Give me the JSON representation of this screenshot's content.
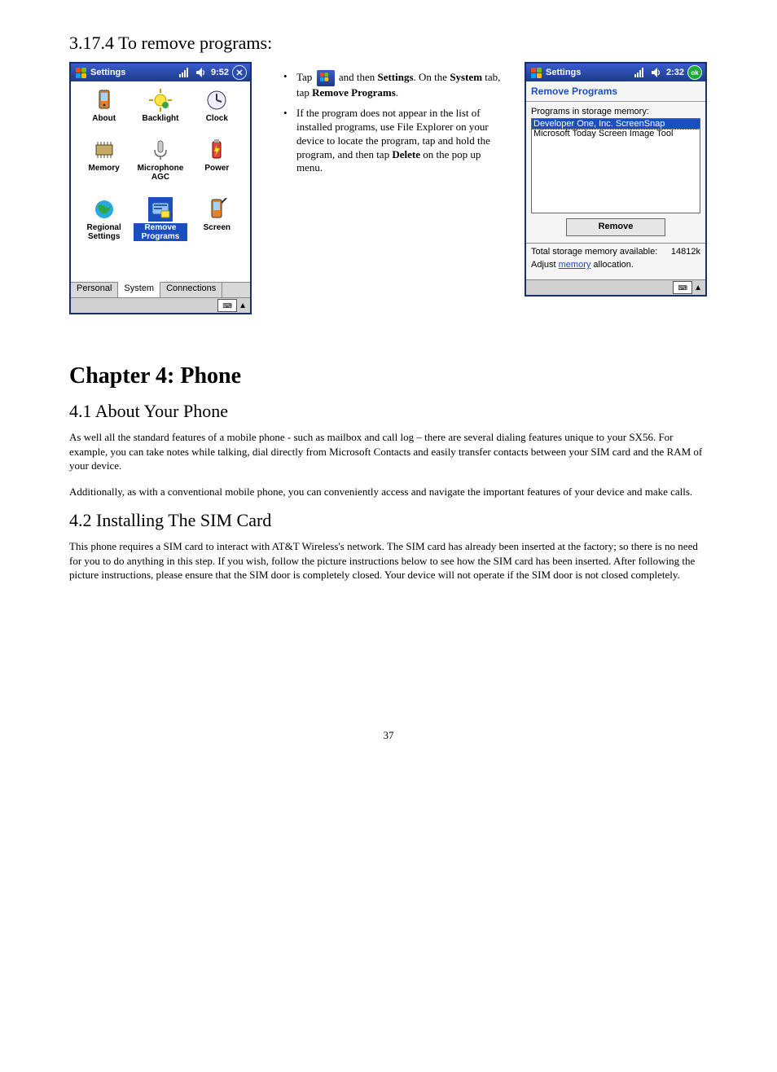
{
  "section_heading": "3.17.4  To remove programs:",
  "device_left": {
    "title": "Settings",
    "time": "9:52",
    "tiles": [
      {
        "label": "About",
        "icon": "about"
      },
      {
        "label": "Backlight",
        "icon": "backlight"
      },
      {
        "label": "Clock",
        "icon": "clock"
      },
      {
        "label": "Memory",
        "icon": "memory"
      },
      {
        "label": "Microphone AGC",
        "icon": "mic"
      },
      {
        "label": "Power",
        "icon": "power"
      },
      {
        "label": "Regional Settings",
        "icon": "globe"
      },
      {
        "label": "Remove Programs",
        "icon": "remove",
        "selected": true
      },
      {
        "label": "Screen",
        "icon": "screen"
      }
    ],
    "tabs": [
      "Personal",
      "System",
      "Connections"
    ],
    "active_tab": "System"
  },
  "bullets": {
    "b1_pre": "Tap ",
    "b1_mid": " and then ",
    "b1_settings": "Settings",
    "b1_after_settings": ". On the ",
    "b1_system": "System",
    "b1_after_system": " tab, tap ",
    "b1_rp": "Remove Programs",
    "b1_end": ".",
    "b2_pre": "If the program does not appear in the list of installed programs, use File Explorer on your device to locate the program, tap and hold the program, and then tap ",
    "b2_delete": "Delete",
    "b2_post": " on the pop up menu."
  },
  "device_right": {
    "title": "Settings",
    "time": "2:32",
    "panel_title": "Remove Programs",
    "list_label": "Programs in storage memory:",
    "list": [
      {
        "text": "Developer One, Inc. ScreenSnap",
        "selected": true
      },
      {
        "text": "Microsoft Today Screen Image Tool",
        "selected": false
      }
    ],
    "remove_label": "Remove",
    "total_label": "Total storage memory available:",
    "total_value": "14812k",
    "adjust_pre": "Adjust ",
    "adjust_link": "memory",
    "adjust_post": " allocation."
  },
  "chapter_title": "Chapter 4: Phone",
  "section_41_title": "4.1 About Your Phone",
  "p41_a": "As well all the standard features of a mobile phone - such as mailbox and call log – there are several dialing features unique to your SX56. For example, you can take notes while talking, dial directly from Microsoft Contacts and easily transfer contacts between your SIM card and the RAM of your device.",
  "p41_b": "Additionally, as with a conventional mobile phone, you can conveniently access and navigate the important features of your device and make calls.",
  "section_42_title": "4.2 Installing The SIM Card",
  "p42": "This phone requires a SIM card to interact with AT&T Wireless's network.  The SIM card has already been inserted at the factory; so there is no need for you to do anything in this step.  If you wish, follow the picture instructions below to see how the SIM card has been inserted.  After following the picture instructions, please ensure that the SIM door is completely closed.  Your device will not operate if the SIM door is not closed completely.",
  "page_number": "37"
}
